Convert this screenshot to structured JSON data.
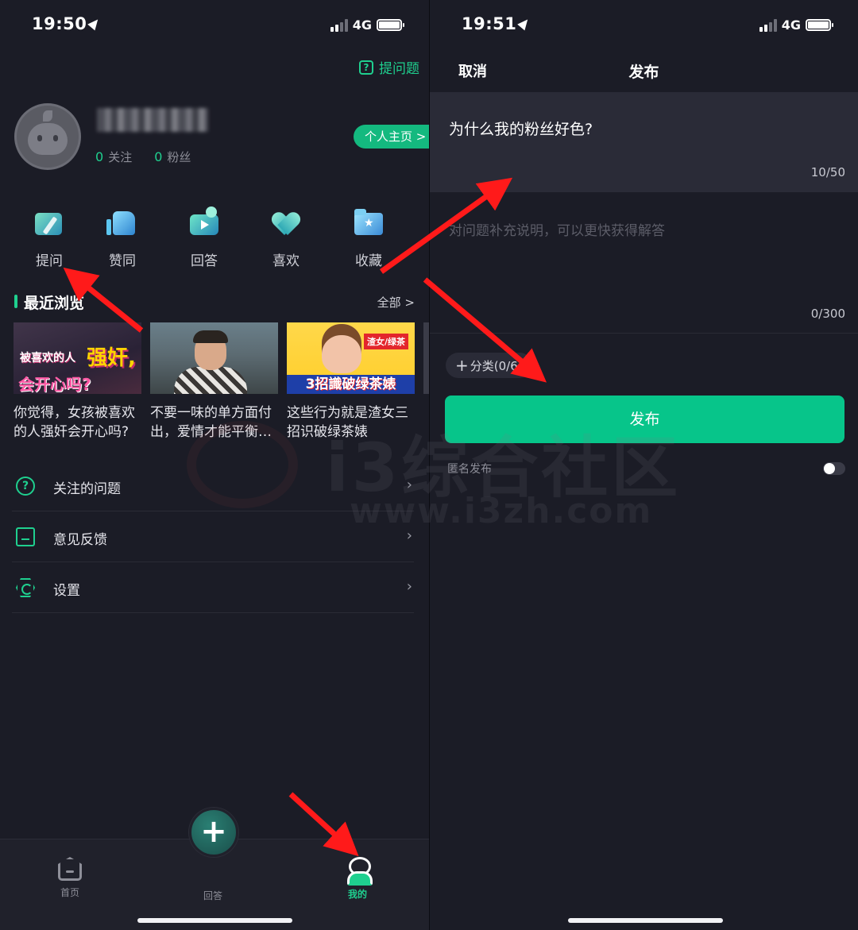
{
  "left": {
    "status": {
      "time": "19:50",
      "network": "4G"
    },
    "header": {
      "ask_label": "提问题"
    },
    "profile": {
      "following_count": "0",
      "following_label": "关注",
      "followers_count": "0",
      "followers_label": "粉丝",
      "homepage_label": "个人主页 >"
    },
    "actions": [
      {
        "label": "提问",
        "icon": "ask-icon"
      },
      {
        "label": "赞同",
        "icon": "thumbs-up-icon"
      },
      {
        "label": "回答",
        "icon": "video-answer-icon"
      },
      {
        "label": "喜欢",
        "icon": "heart-icon"
      },
      {
        "label": "收藏",
        "icon": "folder-star-icon"
      }
    ],
    "recent": {
      "title": "最近浏览",
      "all_label": "全部 >",
      "items": [
        {
          "caption": "你觉得，女孩被喜欢的人强奸会开心吗?",
          "thumb_line1": "被喜欢的人",
          "thumb_big": "强奸,",
          "thumb_line2": "会开心吗?"
        },
        {
          "caption": "不要一味的单方面付出，爱情才能平衡…"
        },
        {
          "caption": "这些行为就是渣女三招识破绿茶婊",
          "thumb_tag": "渣女/绿茶",
          "thumb_strip": "3招識破绿茶婊"
        },
        {
          "caption": ""
        }
      ]
    },
    "menu": [
      {
        "label": "关注的问题",
        "icon": "question-circle-icon"
      },
      {
        "label": "意见反馈",
        "icon": "feedback-icon"
      },
      {
        "label": "设置",
        "icon": "settings-icon"
      }
    ],
    "tabbar": {
      "home_label": "首页",
      "answer_label": "回答",
      "me_label": "我的"
    }
  },
  "right": {
    "status": {
      "time": "19:51",
      "network": "4G"
    },
    "nav": {
      "cancel_label": "取消",
      "title": "发布"
    },
    "question": {
      "value": "为什么我的粉丝好色?",
      "count": "10/50"
    },
    "description": {
      "placeholder": "对问题补充说明，可以更快获得解答",
      "count": "0/300"
    },
    "category": {
      "label": "分类(0/6)"
    },
    "publish_label": "发布",
    "anonymous_label": "匿名发布"
  },
  "watermark": {
    "brand": "i3综合社区",
    "url": "www.i3zh.com"
  },
  "colors": {
    "accent": "#1fd08f",
    "publish": "#07c58a",
    "background": "#1b1c26",
    "arrow": "#ff1a1a"
  }
}
